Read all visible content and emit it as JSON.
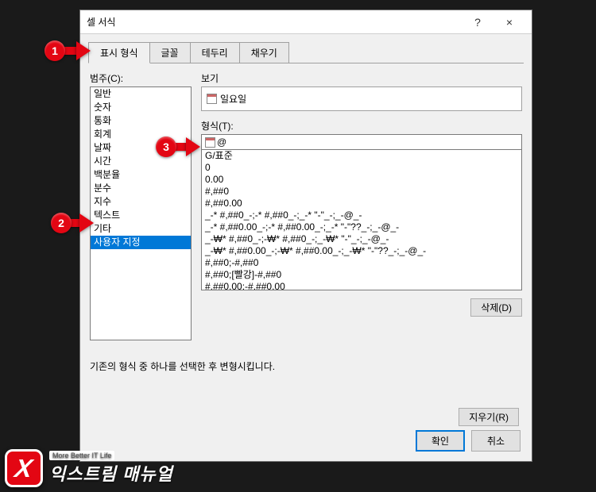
{
  "dialog": {
    "title": "셀 서식",
    "help_symbol": "?",
    "close_symbol": "×"
  },
  "tabs": [
    {
      "label": "표시 형식",
      "active": true
    },
    {
      "label": "글꼴",
      "active": false
    },
    {
      "label": "테두리",
      "active": false
    },
    {
      "label": "채우기",
      "active": false
    }
  ],
  "category": {
    "label": "범주(C):",
    "items": [
      "일반",
      "숫자",
      "통화",
      "회계",
      "날짜",
      "시간",
      "백분율",
      "분수",
      "지수",
      "텍스트",
      "기타",
      "사용자 지정"
    ],
    "selected_index": 11
  },
  "preview": {
    "label": "보기",
    "value": "일요일"
  },
  "type": {
    "label": "형식(T):",
    "value": "@"
  },
  "format_list": [
    "G/표준",
    "0",
    "0.00",
    "#,##0",
    "#,##0.00",
    "_-* #,##0_-;-* #,##0_-;_-* \"-\"_-;_-@_-",
    "_-* #,##0.00_-;-* #,##0.00_-;_-* \"-\"??_-;_-@_-",
    "_-₩* #,##0_-;-₩* #,##0_-;_-₩* \"-\"_-;_-@_-",
    "_-₩* #,##0.00_-;-₩* #,##0.00_-;_-₩* \"-\"??_-;_-@_-",
    "#,##0;-#,##0",
    "#,##0;[빨강]-#,##0",
    "#,##0.00;-#,##0.00"
  ],
  "buttons": {
    "delete": "삭제(D)",
    "clear": "지우기(R)",
    "ok": "확인",
    "cancel": "취소"
  },
  "help_text": "기존의 형식 중 하나를 선택한 후 변형시킵니다.",
  "markers": {
    "m1": "1",
    "m2": "2",
    "m3": "3"
  },
  "brand": {
    "glyph": "X",
    "tagline": "More Better IT Life",
    "name": "익스트림 매뉴얼"
  }
}
